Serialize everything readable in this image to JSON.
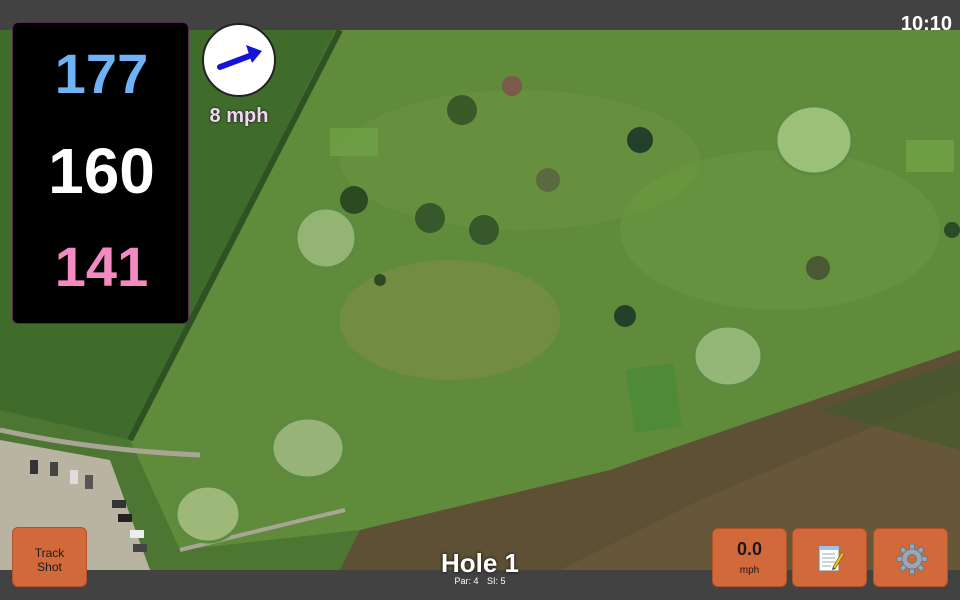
{
  "status_bar": {
    "time": "10:10"
  },
  "distances": {
    "back": "177",
    "middle": "160",
    "front": "141",
    "colors": {
      "back": "#6fb3f6",
      "middle": "#ffffff",
      "front": "#f48ac2"
    }
  },
  "wind": {
    "speed_label": "8 mph",
    "arrow_color": "#1414d8"
  },
  "track_shot": {
    "label_line1": "Track",
    "label_line2": "Shot"
  },
  "hole": {
    "title": "Hole 1",
    "par": "Par: 4",
    "si": "SI: 5"
  },
  "wind_button": {
    "value": "0.0",
    "unit": "mph"
  },
  "icons": {
    "notes": "notepad-icon",
    "settings": "gear-icon"
  },
  "colors": {
    "button": "#d2693a",
    "bar": "#424242",
    "fairway": "#5f8a3c",
    "rough": "#4f7a34"
  }
}
